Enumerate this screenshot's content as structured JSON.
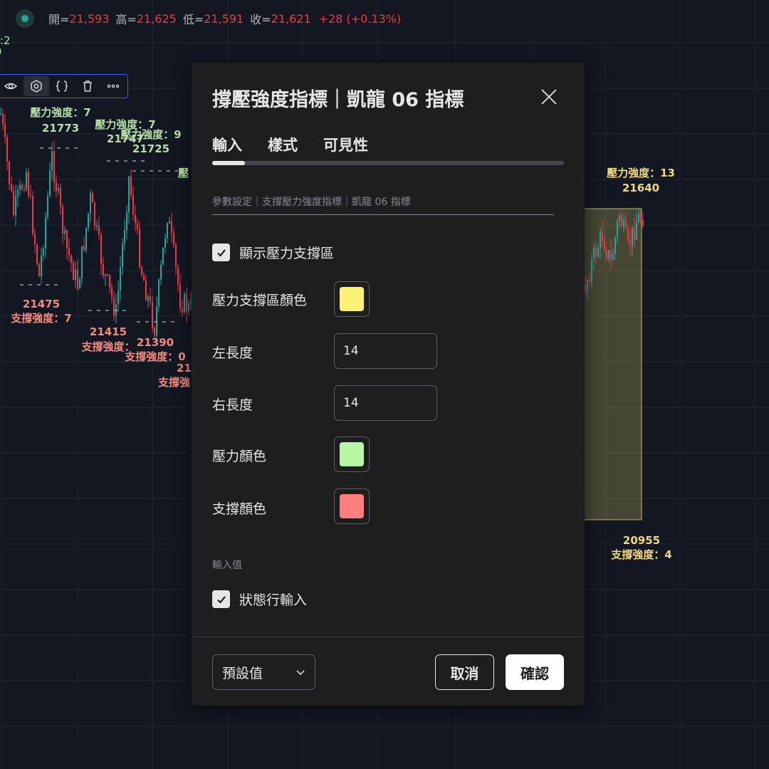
{
  "ohlc": {
    "open_label": "開=",
    "open": "21,593",
    "high_label": "高=",
    "high": "21,625",
    "low_label": "低=",
    "low": "21,591",
    "close_label": "收=",
    "close": "21,621",
    "change": "+28 (+0.13%)"
  },
  "partial_labels": [
    ":2",
    "0"
  ],
  "toolbar": {
    "icons": [
      "eye-icon",
      "settings-icon",
      "source-code-icon",
      "trash-icon",
      "more-icon"
    ]
  },
  "chart_data": {
    "type": "candlestick",
    "resistance_annotations": [
      {
        "label": "壓力強度：7",
        "value": "21773"
      },
      {
        "label": "壓力強度：7",
        "value": "21747"
      },
      {
        "label": "壓力強度：9",
        "value": "21725"
      },
      {
        "label": "壓力強度：13",
        "value": "21640"
      }
    ],
    "support_annotations": [
      {
        "label": "支撐強度：7",
        "value": "21475"
      },
      {
        "label": "支撐強度：",
        "value": "21415"
      },
      {
        "label": "支撐強度：0",
        "value": "21390"
      },
      {
        "label": "支撐強度：4",
        "value": "20955"
      }
    ],
    "truncated_labels": [
      "壓",
      "21",
      "支撐強"
    ],
    "colors": {
      "up": "#26a69a",
      "down": "#f23645",
      "resistance_label": "#b7dfa7",
      "support_label": "#f28b82",
      "zone_fill": "#fff176",
      "zone_label": "#f0d97a"
    }
  },
  "dialog": {
    "title": "撐壓強度指標｜凱龍 06 指標",
    "tabs": [
      "輸入",
      "樣式",
      "可見性"
    ],
    "active_tab": "輸入",
    "section_header": "參數設定｜支撐壓力強度指標｜凱龍 06 指標",
    "show_zone": {
      "label": "顯示壓力支撐區",
      "checked": true
    },
    "zone_color": {
      "label": "壓力支撐區顏色",
      "value": "#fff176"
    },
    "left_length": {
      "label": "左長度",
      "value": "14"
    },
    "right_length": {
      "label": "右長度",
      "value": "14"
    },
    "resistance_color": {
      "label": "壓力顏色",
      "value": "#b9f6a5"
    },
    "support_color": {
      "label": "支撐顏色",
      "value": "#ff7d7d"
    },
    "inputs_section": "輸入值",
    "status_line": {
      "label": "狀態行輸入",
      "checked": true
    },
    "preset_label": "預設值",
    "cancel_label": "取消",
    "ok_label": "確認"
  }
}
